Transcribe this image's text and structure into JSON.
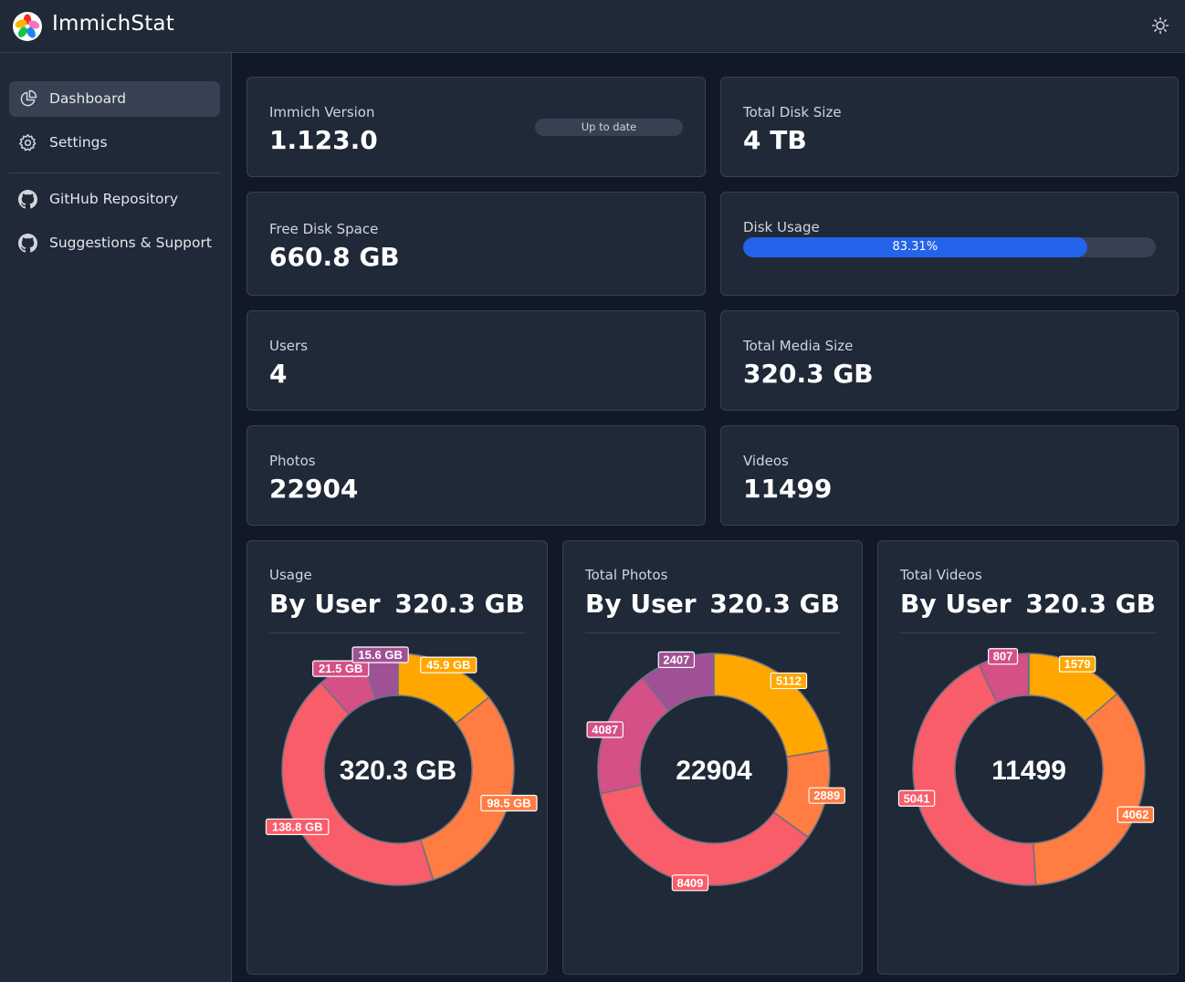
{
  "app": {
    "title": "ImmichStat"
  },
  "header": {
    "logo_icon": "immich-pinwheel-logo",
    "theme_icon": "sun-icon"
  },
  "sidebar": {
    "items": [
      {
        "label": "Dashboard",
        "icon": "pie-chart-icon",
        "active": true
      },
      {
        "label": "Settings",
        "icon": "gear-icon",
        "active": false
      }
    ],
    "links": [
      {
        "label": "GitHub Repository",
        "icon": "github-icon"
      },
      {
        "label": "Suggestions & Support",
        "icon": "github-icon"
      }
    ]
  },
  "stats": {
    "version": {
      "label": "Immich Version",
      "value": "1.123.0",
      "badge": "Up to date"
    },
    "disk_size": {
      "label": "Total Disk Size",
      "value": "4 TB"
    },
    "free_space": {
      "label": "Free Disk Space",
      "value": "660.8 GB"
    },
    "disk_usage": {
      "label": "Disk Usage",
      "percent_text": "83.31%",
      "fraction": 0.8331
    },
    "users": {
      "label": "Users",
      "value": "4"
    },
    "media_size": {
      "label": "Total Media Size",
      "value": "320.3 GB"
    },
    "photos": {
      "label": "Photos",
      "value": "22904"
    },
    "videos": {
      "label": "Videos",
      "value": "11499"
    }
  },
  "colors": {
    "accent": "#2563eb",
    "slices": [
      "#ffa600",
      "#ff7c43",
      "#f95d6a",
      "#d45087",
      "#a05195"
    ]
  },
  "chart_data": [
    {
      "type": "pie",
      "label": "Usage",
      "title": "By User",
      "total": "320.3 GB",
      "center_text": "320.3 GB",
      "values": [
        45.9,
        98.5,
        138.8,
        21.5,
        15.6
      ],
      "labels": [
        "45.9 GB",
        "98.5 GB",
        "138.8 GB",
        "21.5 GB",
        "15.6 GB"
      ]
    },
    {
      "type": "pie",
      "label": "Total Photos",
      "title": "By User",
      "total": "320.3 GB",
      "center_text": "22904",
      "values": [
        5112,
        2889,
        8409,
        4087,
        2407
      ],
      "labels": [
        "5112",
        "2889",
        "8409",
        "4087",
        "2407"
      ]
    },
    {
      "type": "pie",
      "label": "Total Videos",
      "title": "By User",
      "total": "320.3 GB",
      "center_text": "11499",
      "values": [
        1579,
        4062,
        5041,
        807,
        10
      ],
      "labels": [
        "1579",
        "4062",
        "5041",
        "807",
        ""
      ]
    }
  ]
}
